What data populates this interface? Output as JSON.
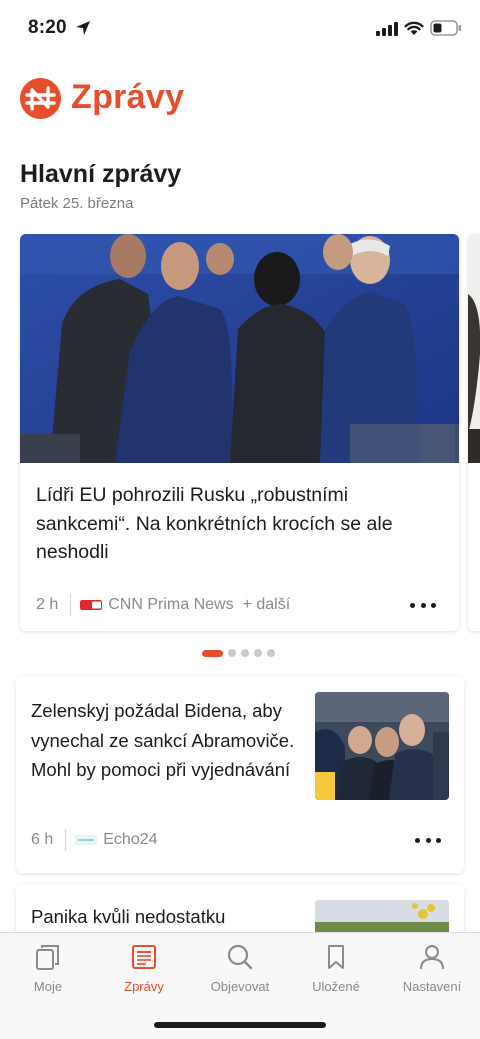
{
  "status": {
    "time": "8:20"
  },
  "app": {
    "title": "Zprávy",
    "brand_color": "#e84e2c"
  },
  "section": {
    "title": "Hlavní zprávy",
    "date": "Pátek 25. března"
  },
  "featured": {
    "headline": "Lídři EU pohrozili Rusku „robustními sankcemi“. Na konkrétních krocích se ale neshodli",
    "time": "2 h",
    "source": "CNN Prima News",
    "more_sources": "+ další",
    "pager": {
      "count": 5,
      "active": 1
    }
  },
  "articles": [
    {
      "headline": "Zelenskyj požádal Bidena, aby vynechal ze sankcí Abramoviče. Mohl by pomoci při vyjednávání",
      "time": "6 h",
      "source": "Echo24"
    },
    {
      "headline": "Panika kvůli nedostatku"
    }
  ],
  "tabs": [
    {
      "label": "Moje",
      "icon": "stack-icon"
    },
    {
      "label": "Zprávy",
      "icon": "newspaper-icon",
      "active": true
    },
    {
      "label": "Objevovat",
      "icon": "search-icon"
    },
    {
      "label": "Uložené",
      "icon": "bookmark-icon"
    },
    {
      "label": "Nastavení",
      "icon": "person-icon"
    }
  ]
}
